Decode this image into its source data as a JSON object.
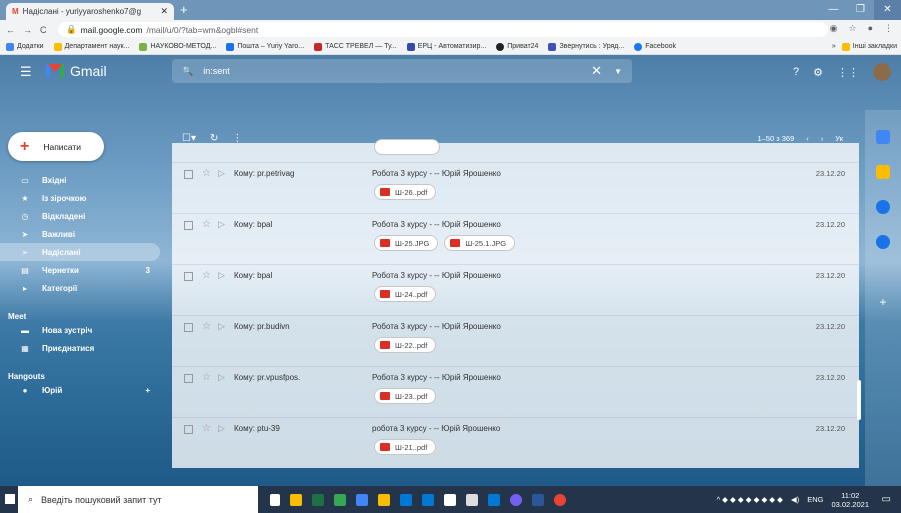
{
  "browser": {
    "tab_title": "Надіслані - yuriyyaroshenko7@g",
    "tab_close": "✕",
    "new_tab": "+",
    "url_domain": "mail.google.com",
    "url_path": "/mail/u/0/?tab=wm&ogbl#sent",
    "bookmarks": [
      "Додатки",
      "Департамент наук...",
      "НАУКОВО-МЕТОД...",
      "Пошта – Yuriy Yaro...",
      "ТАСС ТРЕВЕЛ — Ту...",
      "ЕРЦ - Автоматизир...",
      "Приват24",
      "Звернутись : Уряд...",
      "Facebook"
    ],
    "bookmarks_more": "»",
    "other_bookmarks": "Інші закладки"
  },
  "gmail": {
    "logo_text": "Gmail",
    "search_value": "in:sent",
    "compose_label": "Написати",
    "nav": [
      {
        "label": "Вхідні",
        "icon": "inbox-icon",
        "count": ""
      },
      {
        "label": "Із зірочкою",
        "icon": "star-icon",
        "count": ""
      },
      {
        "label": "Відкладені",
        "icon": "clock-icon",
        "count": ""
      },
      {
        "label": "Важливі",
        "icon": "important-icon",
        "count": ""
      },
      {
        "label": "Надіслані",
        "icon": "send-icon",
        "count": ""
      },
      {
        "label": "Чернетки",
        "icon": "draft-icon",
        "count": "3"
      },
      {
        "label": "Категорії",
        "icon": "label-icon",
        "count": ""
      }
    ],
    "meet_title": "Meet",
    "meet_new": "Нова зустріч",
    "meet_join": "Приєднатися",
    "hangouts_title": "Hangouts",
    "hangouts_user": "Юрій",
    "pager_text": "1–50 з 369",
    "lang": "Ук",
    "emails": [
      {
        "to": "Кому: pr.petrivag",
        "subject": "Робота 3 курсу - -- Юрій Ярошенко",
        "date": "23.12.20",
        "files": [
          "Ш-26..pdf"
        ]
      },
      {
        "to": "Кому: bpal",
        "subject": "Робота 3 курсу - -- Юрій Ярошенко",
        "date": "23.12.20",
        "files": [
          "Ш-25.JPG",
          "Ш-25.1.JPG"
        ]
      },
      {
        "to": "Кому: bpal",
        "subject": "Робота 3 курсу - -- Юрій Ярошенко",
        "date": "23.12.20",
        "files": [
          "Ш-24..pdf"
        ]
      },
      {
        "to": "Кому: pr.budivn",
        "subject": "Робота 3 курсу - -- Юрій Ярошенко",
        "date": "23.12.20",
        "files": [
          "Ш-22..pdf"
        ]
      },
      {
        "to": "Кому: pr.vpusfpos.",
        "subject": "Робота 3 курсу - -- Юрій Ярошенко",
        "date": "23.12.20",
        "files": [
          "Ш-23..pdf"
        ]
      },
      {
        "to": "Кому: ptu-39",
        "subject": "робота 3 курсу - -- Юрій Ярошенко",
        "date": "23.12.20",
        "files": [
          "Ш-21..pdf"
        ]
      }
    ]
  },
  "taskbar": {
    "search_placeholder": "Введіть пошуковий запит тут",
    "lang": "ENG",
    "time": "11:02",
    "date": "03.02.2021"
  },
  "colors": {
    "accent": "#ea4335",
    "pdf": "#d93025"
  }
}
